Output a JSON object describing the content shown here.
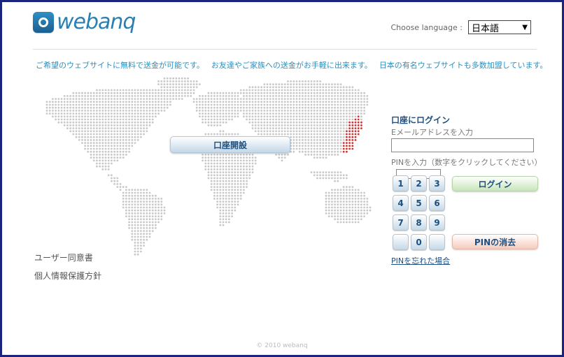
{
  "brand": {
    "name": "webanq"
  },
  "language": {
    "label": "Choose language :",
    "selected": "日本語"
  },
  "taglines": [
    "ご希望のウェブサイトに無料で送金が可能です。",
    "お友達やご家族への送金がお手軽に出来ます。",
    "日本の有名ウェブサイトも多数加盟しています。"
  ],
  "map": {
    "dot_color": "#c8c8c8",
    "highlight_color": "#d23232",
    "highlight_region": "Japan"
  },
  "open_account_label": "口座開設",
  "left_links": [
    "ユーザー同意書",
    "個人情報保護方針"
  ],
  "login": {
    "title": "口座にログイン",
    "email_label": "Eメールアドレスを入力",
    "email_value": "",
    "pin_label": "PINを入力（数字をクリックしてください）",
    "pin_value": "",
    "keypad": [
      "1",
      "2",
      "3",
      "4",
      "5",
      "6",
      "7",
      "8",
      "9",
      "",
      "0",
      ""
    ],
    "login_button": "ログイン",
    "clear_button": "PINの消去",
    "forgot_link": "PINを忘れた場合"
  },
  "footer": "© 2010 webanq"
}
